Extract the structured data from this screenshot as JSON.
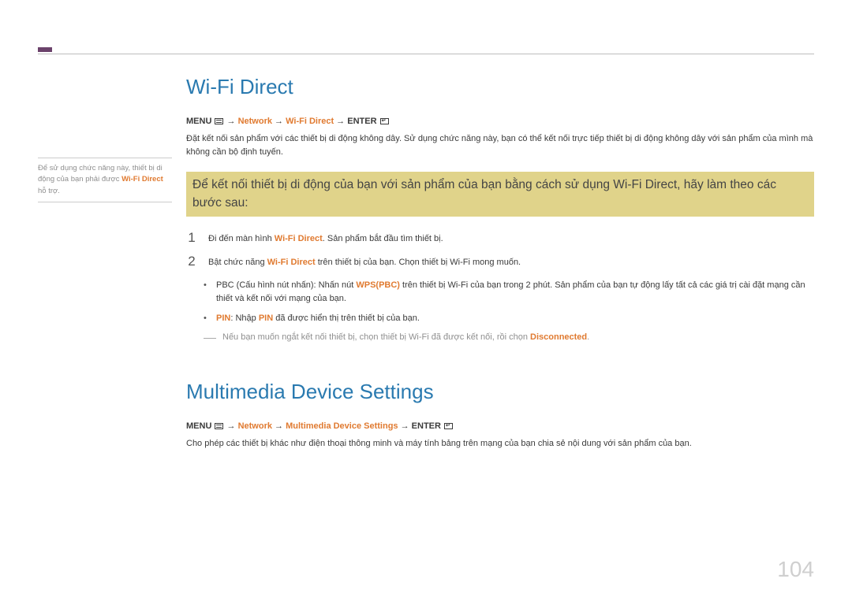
{
  "sidebar": {
    "note_prefix": "Để sử dụng chức năng này, thiết bị di động của bạn phải được ",
    "note_highlight": "Wi-Fi Direct",
    "note_suffix": " hỗ trợ."
  },
  "section1": {
    "heading": "Wi-Fi Direct",
    "breadcrumb": {
      "menu": "MENU",
      "arrow": " → ",
      "network": "Network",
      "wifidirect": "Wi-Fi Direct",
      "enter": "ENTER"
    },
    "intro": "Đặt kết nối sản phẩm với các thiết bị di động không dây. Sử dụng chức năng này, bạn có thể kết nối trực tiếp thiết bị di động không dây với sản phẩm của mình mà không cần bộ định tuyến.",
    "callout": "Để kết nối thiết bị di động của bạn với sản phẩm của bạn bằng cách sử dụng Wi-Fi Direct, hãy làm theo các bước sau:",
    "step1": {
      "num": "1",
      "prefix": "Đi đến màn hình ",
      "highlight": "Wi-Fi Direct",
      "suffix": ". Sản phẩm bắt đầu tìm thiết bị."
    },
    "step2": {
      "num": "2",
      "prefix": "Bật chức năng ",
      "highlight": "Wi-Fi Direct",
      "suffix": " trên thiết bị của bạn. Chọn thiết bị Wi-Fi mong muốn."
    },
    "bullet1": {
      "prefix": "PBC (Cấu hình nút nhấn): Nhấn nút ",
      "highlight": "WPS(PBC)",
      "suffix": " trên thiết bị Wi-Fi của bạn trong 2 phút. Sản phẩm của bạn tự động lấy tất cả các giá trị cài đặt mạng cần thiết và kết nối với mạng của bạn."
    },
    "bullet2": {
      "hl1": "PIN",
      "mid": ": Nhập ",
      "hl2": "PIN",
      "suffix": " đã được hiển thị trên thiết bị của bạn."
    },
    "note": {
      "prefix": "Nếu bạn muốn ngắt kết nối thiết bị, chọn thiết bị Wi-Fi đã được kết nối, rồi chọn ",
      "highlight": "Disconnected",
      "suffix": "."
    }
  },
  "section2": {
    "heading": "Multimedia Device Settings",
    "breadcrumb": {
      "menu": "MENU",
      "arrow": " → ",
      "network": "Network",
      "mds": "Multimedia Device Settings",
      "enter": "ENTER"
    },
    "body": "Cho phép các thiết bị khác như điện thoại thông minh và máy tính bảng trên mạng của bạn chia sẻ nội dung với sản phẩm của bạn."
  },
  "pageNumber": "104"
}
